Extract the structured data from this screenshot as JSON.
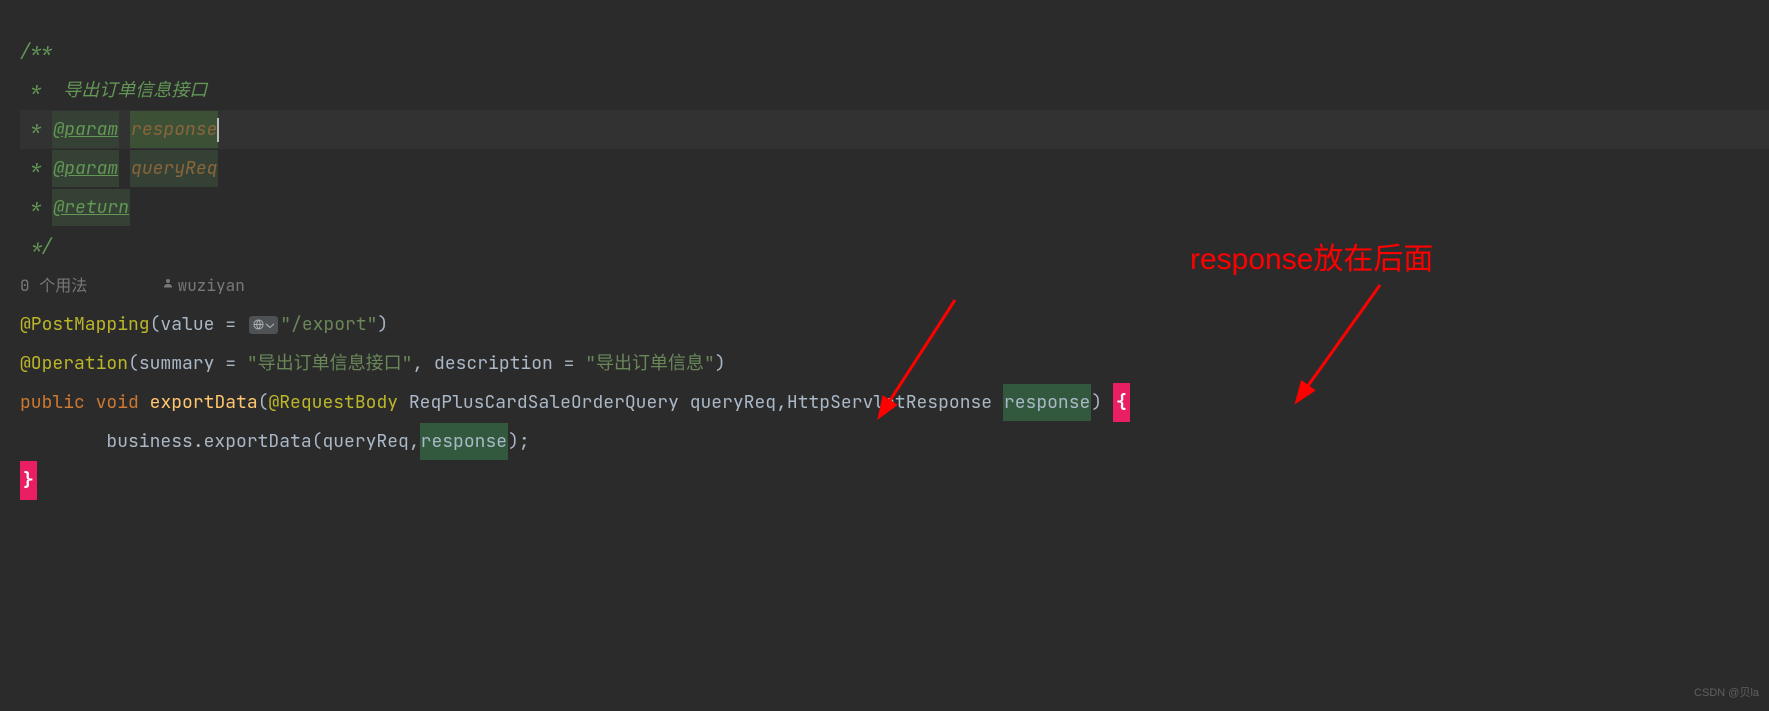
{
  "doc": {
    "open": "/**",
    "line1_prefix": " *  ",
    "line1_text": "导出订单信息接口",
    "line2_prefix": " * ",
    "tag_param": "@param",
    "param1": "response",
    "line3_prefix": " * ",
    "param2": "queryReq",
    "line4_prefix": " * ",
    "tag_return": "@return",
    "close": " */"
  },
  "hints": {
    "usages": "0 个用法",
    "author_icon": "👤",
    "author": "wuziyan"
  },
  "code": {
    "anno_post": "@PostMapping",
    "value_eq": "value = ",
    "url_icon_glyph": "🌐⌄",
    "str_export": "\"/export\"",
    "anno_op": "@Operation",
    "summary_eq": "summary = ",
    "str_summary": "\"导出订单信息接口\"",
    "desc_eq": ", description = ",
    "str_desc": "\"导出订单信息\"",
    "kw_public": "public",
    "kw_void": "void",
    "m_export": "exportData",
    "anno_body": "@RequestBody",
    "cls_req": "ReqPlusCardSaleOrderQuery",
    "var_queryreq": "queryReq",
    "cls_resp": "HttpServletResponse",
    "var_response": "response",
    "indent": "        ",
    "biz": "business",
    "comma": ",",
    "paren_open": "(",
    "paren_close": ")",
    "brace_open": "{",
    "brace_close": "}",
    "semi": ";",
    "space": " "
  },
  "overlay": {
    "text": "response放在后面"
  },
  "watermark": "CSDN @贝la"
}
